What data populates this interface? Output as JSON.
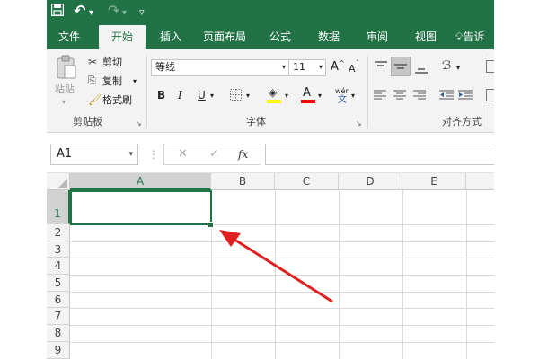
{
  "quick_access": {
    "save_icon": "save-icon",
    "undo": "↶",
    "undo_dropdown": "▾",
    "redo": "↷",
    "redo_dropdown": "▾",
    "customize": "▿"
  },
  "tabs": [
    "文件",
    "开始",
    "插入",
    "页面布局",
    "公式",
    "数据",
    "审阅",
    "视图"
  ],
  "tell_me": {
    "icon": "lightbulb-icon",
    "label": "告诉"
  },
  "ribbon": {
    "clipboard": {
      "paste": "粘贴",
      "cut": "剪切",
      "copy": "复制",
      "format_painter": "格式刷",
      "group_label": "剪贴板"
    },
    "font": {
      "name": "等线",
      "size": "11",
      "grow": "A",
      "shrink": "A",
      "bold": "B",
      "italic": "I",
      "underline": "U",
      "phonetic_top": "wén",
      "phonetic_bottom": "文",
      "group_label": "字体",
      "fill_color": "#ffff00",
      "font_color": "#ff0000"
    },
    "alignment": {
      "group_label": "对齐方式"
    }
  },
  "formula_bar": {
    "name_box": "A1",
    "cancel": "✕",
    "enter": "✓",
    "fx": "fx",
    "content": ""
  },
  "grid": {
    "columns": [
      "A",
      "B",
      "C",
      "D",
      "E",
      "F"
    ],
    "rows": [
      "1",
      "2",
      "3",
      "4",
      "5",
      "6",
      "7",
      "8",
      "9"
    ],
    "selected_cell": "A1",
    "accent": "#217346",
    "annotation_color": "#e02020"
  }
}
